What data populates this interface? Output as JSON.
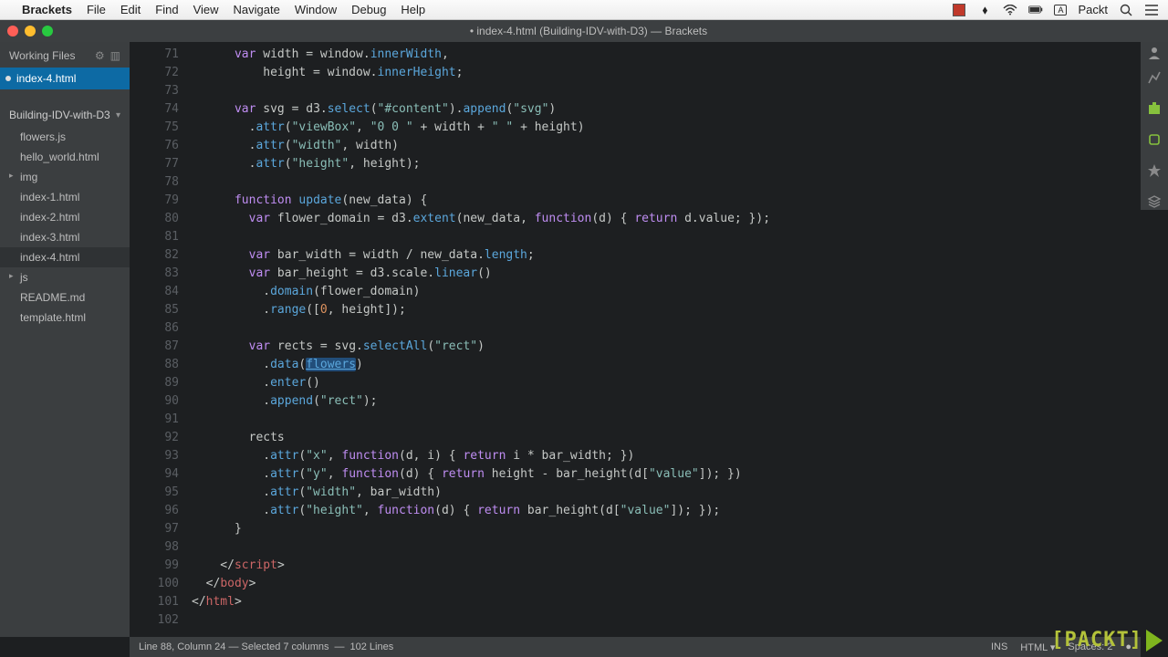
{
  "menubar": {
    "apple": "",
    "app": "Brackets",
    "items": [
      "File",
      "Edit",
      "Find",
      "View",
      "Navigate",
      "Window",
      "Debug",
      "Help"
    ],
    "tray_user": "Packt"
  },
  "titlebar": {
    "title": "• index-4.html (Building-IDV-with-D3) — Brackets"
  },
  "sidebar": {
    "working_header": "Working Files",
    "working_files": [
      {
        "label": "index-4.html",
        "active": true,
        "dirty": true
      }
    ],
    "project_name": "Building-IDV-with-D3",
    "tree": [
      {
        "label": "flowers.js",
        "type": "file"
      },
      {
        "label": "hello_world.html",
        "type": "file"
      },
      {
        "label": "img",
        "type": "folder"
      },
      {
        "label": "index-1.html",
        "type": "file"
      },
      {
        "label": "index-2.html",
        "type": "file"
      },
      {
        "label": "index-3.html",
        "type": "file"
      },
      {
        "label": "index-4.html",
        "type": "file",
        "active": true
      },
      {
        "label": "js",
        "type": "folder"
      },
      {
        "label": "README.md",
        "type": "file"
      },
      {
        "label": "template.html",
        "type": "file"
      }
    ]
  },
  "editor": {
    "first_line": 71,
    "selection_word": "flowers",
    "lines": [
      {
        "n": 71,
        "html": "      <span class='kw'>var</span> width = window.<span class='fn'>innerWidth</span>,"
      },
      {
        "n": 72,
        "html": "          height = window.<span class='fn'>innerHeight</span>;"
      },
      {
        "n": 73,
        "html": ""
      },
      {
        "n": 74,
        "html": "      <span class='kw'>var</span> svg = d3.<span class='fn'>select</span>(<span class='str'>\"#content\"</span>).<span class='fn'>append</span>(<span class='str'>\"svg\"</span>)"
      },
      {
        "n": 75,
        "html": "        .<span class='fn'>attr</span>(<span class='str'>\"viewBox\"</span>, <span class='str'>\"0 0 \"</span> + width + <span class='str'>\" \"</span> + height)"
      },
      {
        "n": 76,
        "html": "        .<span class='fn'>attr</span>(<span class='str'>\"width\"</span>, width)"
      },
      {
        "n": 77,
        "html": "        .<span class='fn'>attr</span>(<span class='str'>\"height\"</span>, height);"
      },
      {
        "n": 78,
        "html": ""
      },
      {
        "n": 79,
        "html": "      <span class='kw'>function</span> <span class='fn'>update</span>(new_data) {"
      },
      {
        "n": 80,
        "html": "        <span class='kw'>var</span> flower_domain = d3.<span class='fn'>extent</span>(new_data, <span class='kw'>function</span>(d) { <span class='kw'>return</span> d.value; });"
      },
      {
        "n": 81,
        "html": ""
      },
      {
        "n": 82,
        "html": "        <span class='kw'>var</span> bar_width = width / new_data.<span class='fn'>length</span>;"
      },
      {
        "n": 83,
        "html": "        <span class='kw'>var</span> bar_height = d3.scale.<span class='fn'>linear</span>()"
      },
      {
        "n": 84,
        "html": "          .<span class='fn'>domain</span>(flower_domain)"
      },
      {
        "n": 85,
        "html": "          .<span class='fn'>range</span>([<span class='num'>0</span>, height]);"
      },
      {
        "n": 86,
        "html": ""
      },
      {
        "n": 87,
        "html": "        <span class='kw'>var</span> rects = svg.<span class='fn'>selectAll</span>(<span class='str'>\"rect\"</span>)"
      },
      {
        "n": 88,
        "html": "          .<span class='fn'>data</span>(<span class='sel underline fn'>flowers</span>)"
      },
      {
        "n": 89,
        "html": "          .<span class='fn'>enter</span>()"
      },
      {
        "n": 90,
        "html": "          .<span class='fn'>append</span>(<span class='str'>\"rect\"</span>);"
      },
      {
        "n": 91,
        "html": ""
      },
      {
        "n": 92,
        "html": "        rects"
      },
      {
        "n": 93,
        "html": "          .<span class='fn'>attr</span>(<span class='str'>\"x\"</span>, <span class='kw'>function</span>(d, i) { <span class='kw'>return</span> i * bar_width; })"
      },
      {
        "n": 94,
        "html": "          .<span class='fn'>attr</span>(<span class='str'>\"y\"</span>, <span class='kw'>function</span>(d) { <span class='kw'>return</span> height - bar_height(d[<span class='str'>\"value\"</span>]); })"
      },
      {
        "n": 95,
        "html": "          .<span class='fn'>attr</span>(<span class='str'>\"width\"</span>, bar_width)"
      },
      {
        "n": 96,
        "html": "          .<span class='fn'>attr</span>(<span class='str'>\"height\"</span>, <span class='kw'>function</span>(d) { <span class='kw'>return</span> bar_height(d[<span class='str'>\"value\"</span>]); });"
      },
      {
        "n": 97,
        "html": "      }"
      },
      {
        "n": 98,
        "html": ""
      },
      {
        "n": 99,
        "html": "    &lt;/<span class='tag'>script</span>&gt;"
      },
      {
        "n": 100,
        "html": "  &lt;/<span class='tag'>body</span>&gt;"
      },
      {
        "n": 101,
        "html": "&lt;/<span class='tag'>html</span>&gt;"
      },
      {
        "n": 102,
        "html": ""
      }
    ]
  },
  "status": {
    "cursor": "Line 88, Column 24 — Selected 7 columns",
    "lines": "102 Lines",
    "ins": "INS",
    "lang": "HTML",
    "spaces": "Spaces: 2"
  },
  "packt_logo": "[PACKT]"
}
